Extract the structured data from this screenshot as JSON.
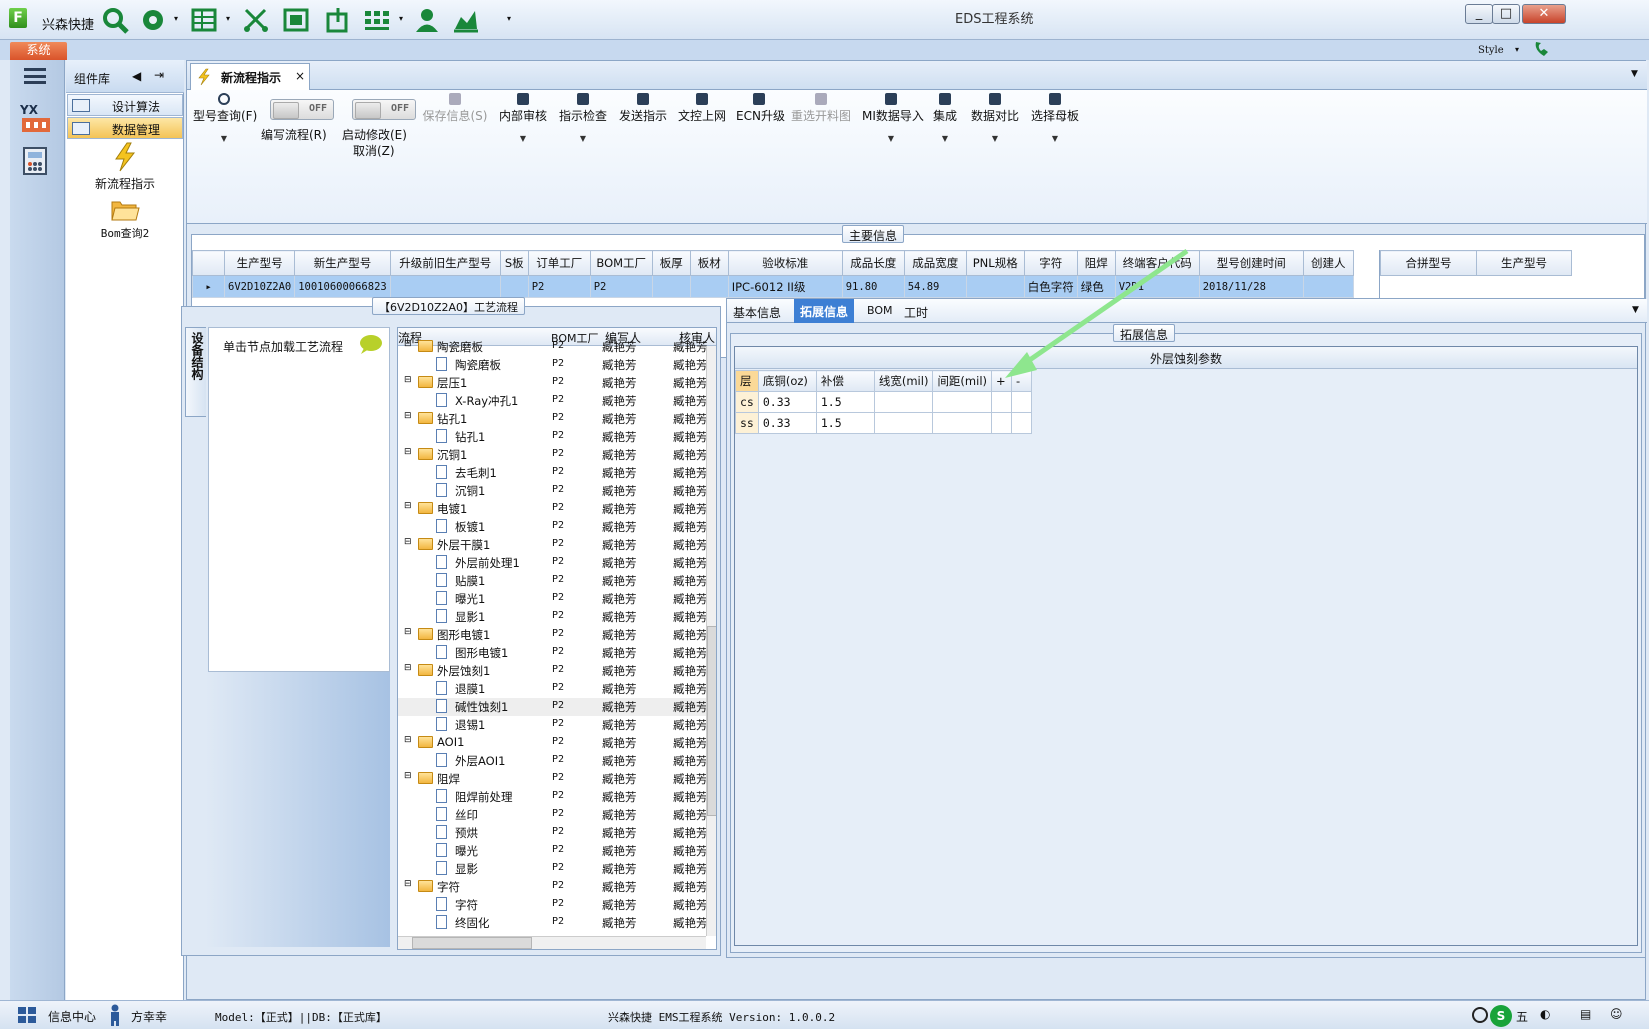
{
  "app": {
    "name": "兴森快捷",
    "window_title": "EDS工程系统",
    "menu_system": "系统",
    "style_label": "Style"
  },
  "library": {
    "title": "组件库",
    "items": [
      {
        "label": "设计算法"
      },
      {
        "label": "数据管理"
      }
    ],
    "tools": [
      {
        "label": "新流程指示"
      },
      {
        "label": "Bom查询2"
      }
    ]
  },
  "tab": {
    "label": "新流程指示",
    "close": "×"
  },
  "toolbar": {
    "model_query": "型号查询(F)",
    "write_flow": "编写流程(R)",
    "start_modify": "启动修改(E)",
    "cancel": "取消(Z)",
    "toggle_off": "OFF",
    "save_info": "保存信息(S)",
    "internal_review": "内部审核",
    "instruction_check": "指示检查",
    "send_instruction": "发送指示",
    "doc_control": "文控上网",
    "ecn_upgrade": "ECN升级",
    "reselect_material": "重选开料图",
    "mi_import": "MI数据导入",
    "integrate": "集成",
    "data_compare": "数据对比",
    "select_mother": "选择母板"
  },
  "main_info": {
    "title": "主要信息",
    "columns": [
      "生产型号",
      "新生产型号",
      "升级前旧生产型号",
      "S板",
      "订单工厂",
      "BOM工厂",
      "板厚",
      "板材",
      "验收标准",
      "成品长度",
      "成品宽度",
      "PNL规格",
      "字符",
      "阻焊",
      "终端客户代码",
      "型号创建时间",
      "创建人"
    ],
    "row": [
      "6V2D10Z2A0",
      "10010600066823",
      "",
      "",
      "P2",
      "P2",
      "",
      "",
      "IPC-6012 II级",
      "91.80",
      "54.89",
      "",
      "白色字符",
      "绿色",
      "V2D1",
      "2018/11/28",
      ""
    ],
    "side_columns": [
      "合拼型号",
      "生产型号"
    ]
  },
  "flow": {
    "title": "【6V2D10Z2A0】工艺流程",
    "side_tab": "设备结构",
    "hint": "单击节点加载工艺流程",
    "columns": [
      "流程",
      "BOM工厂",
      "编写人",
      "核审人"
    ],
    "rows": [
      {
        "label": "陶瓷磨板",
        "type": "folder",
        "level": 0,
        "bom": "P2",
        "writer": "臧艳芳",
        "reviewer": "臧艳芳"
      },
      {
        "label": "陶瓷磨板",
        "type": "doc",
        "level": 1,
        "bom": "P2",
        "writer": "臧艳芳",
        "reviewer": "臧艳芳"
      },
      {
        "label": "层压1",
        "type": "folder",
        "level": 0,
        "bom": "P2",
        "writer": "臧艳芳",
        "reviewer": "臧艳芳"
      },
      {
        "label": "X-Ray冲孔1",
        "type": "doc",
        "level": 1,
        "bom": "P2",
        "writer": "臧艳芳",
        "reviewer": "臧艳芳"
      },
      {
        "label": "钻孔1",
        "type": "folder",
        "level": 0,
        "bom": "P2",
        "writer": "臧艳芳",
        "reviewer": "臧艳芳"
      },
      {
        "label": "钻孔1",
        "type": "doc",
        "level": 1,
        "bom": "P2",
        "writer": "臧艳芳",
        "reviewer": "臧艳芳"
      },
      {
        "label": "沉铜1",
        "type": "folder",
        "level": 0,
        "bom": "P2",
        "writer": "臧艳芳",
        "reviewer": "臧艳芳"
      },
      {
        "label": "去毛刺1",
        "type": "doc",
        "level": 1,
        "bom": "P2",
        "writer": "臧艳芳",
        "reviewer": "臧艳芳"
      },
      {
        "label": "沉铜1",
        "type": "doc",
        "level": 1,
        "bom": "P2",
        "writer": "臧艳芳",
        "reviewer": "臧艳芳"
      },
      {
        "label": "电镀1",
        "type": "folder",
        "level": 0,
        "bom": "P2",
        "writer": "臧艳芳",
        "reviewer": "臧艳芳"
      },
      {
        "label": "板镀1",
        "type": "doc",
        "level": 1,
        "bom": "P2",
        "writer": "臧艳芳",
        "reviewer": "臧艳芳"
      },
      {
        "label": "外层干膜1",
        "type": "folder",
        "level": 0,
        "bom": "P2",
        "writer": "臧艳芳",
        "reviewer": "臧艳芳"
      },
      {
        "label": "外层前处理1",
        "type": "doc",
        "level": 1,
        "bom": "P2",
        "writer": "臧艳芳",
        "reviewer": "臧艳芳"
      },
      {
        "label": "贴膜1",
        "type": "doc",
        "level": 1,
        "bom": "P2",
        "writer": "臧艳芳",
        "reviewer": "臧艳芳"
      },
      {
        "label": "曝光1",
        "type": "doc",
        "level": 1,
        "bom": "P2",
        "writer": "臧艳芳",
        "reviewer": "臧艳芳"
      },
      {
        "label": "显影1",
        "type": "doc",
        "level": 1,
        "bom": "P2",
        "writer": "臧艳芳",
        "reviewer": "臧艳芳"
      },
      {
        "label": "图形电镀1",
        "type": "folder",
        "level": 0,
        "bom": "P2",
        "writer": "臧艳芳",
        "reviewer": "臧艳芳"
      },
      {
        "label": "图形电镀1",
        "type": "doc",
        "level": 1,
        "bom": "P2",
        "writer": "臧艳芳",
        "reviewer": "臧艳芳"
      },
      {
        "label": "外层蚀刻1",
        "type": "folder",
        "level": 0,
        "bom": "P2",
        "writer": "臧艳芳",
        "reviewer": "臧艳芳"
      },
      {
        "label": "退膜1",
        "type": "doc",
        "level": 1,
        "bom": "P2",
        "writer": "臧艳芳",
        "reviewer": "臧艳芳"
      },
      {
        "label": "碱性蚀刻1",
        "type": "doc",
        "level": 1,
        "bom": "P2",
        "writer": "臧艳芳",
        "reviewer": "臧艳芳",
        "selected": true
      },
      {
        "label": "退锡1",
        "type": "doc",
        "level": 1,
        "bom": "P2",
        "writer": "臧艳芳",
        "reviewer": "臧艳芳"
      },
      {
        "label": "AOI1",
        "type": "folder",
        "level": 0,
        "bom": "P2",
        "writer": "臧艳芳",
        "reviewer": "臧艳芳"
      },
      {
        "label": "外层AOI1",
        "type": "doc",
        "level": 1,
        "bom": "P2",
        "writer": "臧艳芳",
        "reviewer": "臧艳芳"
      },
      {
        "label": "阻焊",
        "type": "folder",
        "level": 0,
        "bom": "P2",
        "writer": "臧艳芳",
        "reviewer": "臧艳芳"
      },
      {
        "label": "阻焊前处理",
        "type": "doc",
        "level": 1,
        "bom": "P2",
        "writer": "臧艳芳",
        "reviewer": "臧艳芳"
      },
      {
        "label": "丝印",
        "type": "doc",
        "level": 1,
        "bom": "P2",
        "writer": "臧艳芳",
        "reviewer": "臧艳芳"
      },
      {
        "label": "预烘",
        "type": "doc",
        "level": 1,
        "bom": "P2",
        "writer": "臧艳芳",
        "reviewer": "臧艳芳"
      },
      {
        "label": "曝光",
        "type": "doc",
        "level": 1,
        "bom": "P2",
        "writer": "臧艳芳",
        "reviewer": "臧艳芳"
      },
      {
        "label": "显影",
        "type": "doc",
        "level": 1,
        "bom": "P2",
        "writer": "臧艳芳",
        "reviewer": "臧艳芳"
      },
      {
        "label": "字符",
        "type": "folder",
        "level": 0,
        "bom": "P2",
        "writer": "臧艳芳",
        "reviewer": "臧艳芳"
      },
      {
        "label": "字符",
        "type": "doc",
        "level": 1,
        "bom": "P2",
        "writer": "臧艳芳",
        "reviewer": "臧艳芳"
      },
      {
        "label": "终固化",
        "type": "doc",
        "level": 1,
        "bom": "P2",
        "writer": "臧艳芳",
        "reviewer": "臧艳芳"
      }
    ]
  },
  "detail": {
    "tabs": [
      {
        "label": "基本信息"
      },
      {
        "label": "拓展信息",
        "active": true
      },
      {
        "label": "BOM"
      },
      {
        "label": "工时"
      }
    ],
    "group_title": "拓展信息",
    "etch_title": "外层蚀刻参数",
    "etch_columns": [
      "层",
      "底铜(oz)",
      "补偿",
      "线宽(mil)",
      "间距(mil)",
      "+",
      "-"
    ],
    "etch_rows": [
      [
        "cs",
        "0.33",
        "1.5",
        "",
        "",
        "",
        ""
      ],
      [
        "ss",
        "0.33",
        "1.5",
        "",
        "",
        "",
        ""
      ]
    ]
  },
  "status": {
    "info_center": "信息中心",
    "user": "方幸幸",
    "model_db": "Model:【正式】||DB:【正式库】",
    "version": "兴森快捷 EMS工程系统 Version: 1.0.0.2",
    "ime": "五"
  },
  "colors": {
    "accent": "#3d7fd4",
    "selected_row": "#a9cdf3",
    "arrow": "#8ee68e"
  }
}
